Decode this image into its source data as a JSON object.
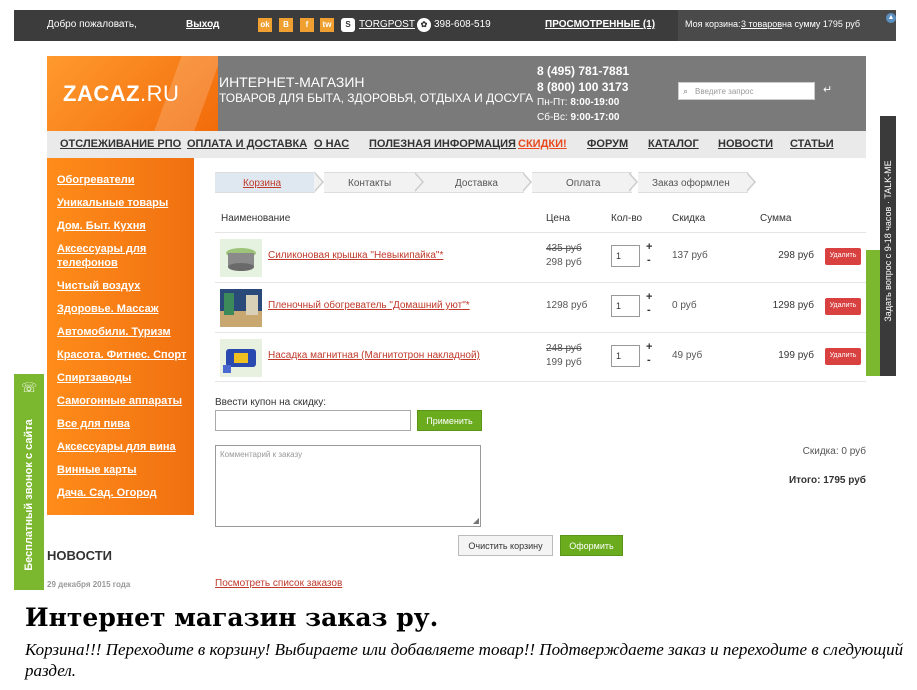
{
  "topbar": {
    "welcome": "Добро пожаловать,",
    "logout": "Выход",
    "social": [
      "ok",
      "B",
      "f",
      "tw"
    ],
    "skype_name": "TORGPOST",
    "icq": "398-608-519",
    "viewed": "ПРОСМОТРЕННЫЕ (1)",
    "cart_prefix": "Моя корзина:",
    "cart_link": "3 товаров",
    "cart_suffix": "на сумму 1795 руб"
  },
  "header": {
    "logo_main": "ZACAZ",
    "logo_tld": ".RU",
    "title1": "ИНТЕРНЕТ-МАГАЗИН",
    "title2": "ТОВАРОВ ДЛЯ БЫТА, ЗДОРОВЬЯ, ОТДЫХА И ДОСУГА",
    "phone1": "8 (495) 781-7881",
    "phone2": "8 (800) 100 3173",
    "hours1_label": "Пн-Пт:",
    "hours1": "8:00-19:00",
    "hours2_label": "Сб-Вс:",
    "hours2": "9:00-17:00",
    "search_placeholder": "Введите запрос"
  },
  "nav": [
    "ОТСЛЕЖИВАНИЕ РПО",
    "ОПЛАТА И ДОСТАВКА",
    "О НАС",
    "ПОЛЕЗНАЯ ИНФОРМАЦИЯ",
    "СКИДКИ!",
    "ФОРУМ",
    "КАТАЛОГ",
    "НОВОСТИ",
    "СТАТЬИ"
  ],
  "sidebar": [
    "Обогреватели",
    "Уникальные товары",
    "Дом. Быт. Кухня",
    "Аксессуары для телефонов",
    "Чистый воздух",
    "Здоровье. Массаж",
    "Автомобили. Туризм",
    "Красота. Фитнес. Спорт",
    "Спиртзаводы",
    "Самогонные аппараты",
    "Все для пива",
    "Аксессуары для вина",
    "Винные карты",
    "Дача. Сад. Огород"
  ],
  "news": {
    "heading": "НОВОСТИ",
    "date": "29 декабря 2015 года"
  },
  "steps": [
    "Корзина",
    "Контакты",
    "Доставка",
    "Оплата",
    "Заказ оформлен"
  ],
  "columns": {
    "name": "Наименование",
    "price": "Цена",
    "qty": "Кол-во",
    "discount": "Скидка",
    "sum": "Сумма"
  },
  "cart_items": [
    {
      "name": "Силиконовая крышка \"Невыкипайка\"*",
      "old_price": "435 руб",
      "price": "298 руб",
      "qty": "1",
      "discount": "137 руб",
      "sum": "298 руб",
      "delete": "Удалить"
    },
    {
      "name": "Пленочный обогреватель \"Домашний уют\"*",
      "old_price": "",
      "price": "1298 руб",
      "qty": "1",
      "discount": "0 руб",
      "sum": "1298 руб",
      "delete": "Удалить"
    },
    {
      "name": "Насадка магнитная (Магнитотрон накладной)",
      "old_price": "248 руб",
      "price": "199 руб",
      "qty": "1",
      "discount": "49 руб",
      "sum": "199 руб",
      "delete": "Удалить"
    }
  ],
  "coupon": {
    "label": "Ввести купон на скидку:",
    "apply": "Применить"
  },
  "comment_placeholder": "Комментарий к заказу",
  "totals": {
    "discount": "Скидка: 0 руб",
    "total": "Итого: 1795 руб"
  },
  "buttons": {
    "clear": "Очистить корзину",
    "checkout": "Оформить"
  },
  "orders_link": "Посмотреть список заказов",
  "left_widget": "Бесплатный звонок с сайта",
  "right_widget": "Задать вопрос с 9-18 часов",
  "right_brand": "TALK-ME",
  "caption": {
    "title": "Интернет магазин заказ ру.",
    "text": "Корзина!!!  Переходите в корзину! Выбираете или добавляете товар!! Подтверждаете заказ и переходите в следующий раздел."
  },
  "colors": {
    "orange": "#f27b12",
    "green": "#6aac1e",
    "red": "#d94040",
    "dark": "#3c3c3c"
  }
}
